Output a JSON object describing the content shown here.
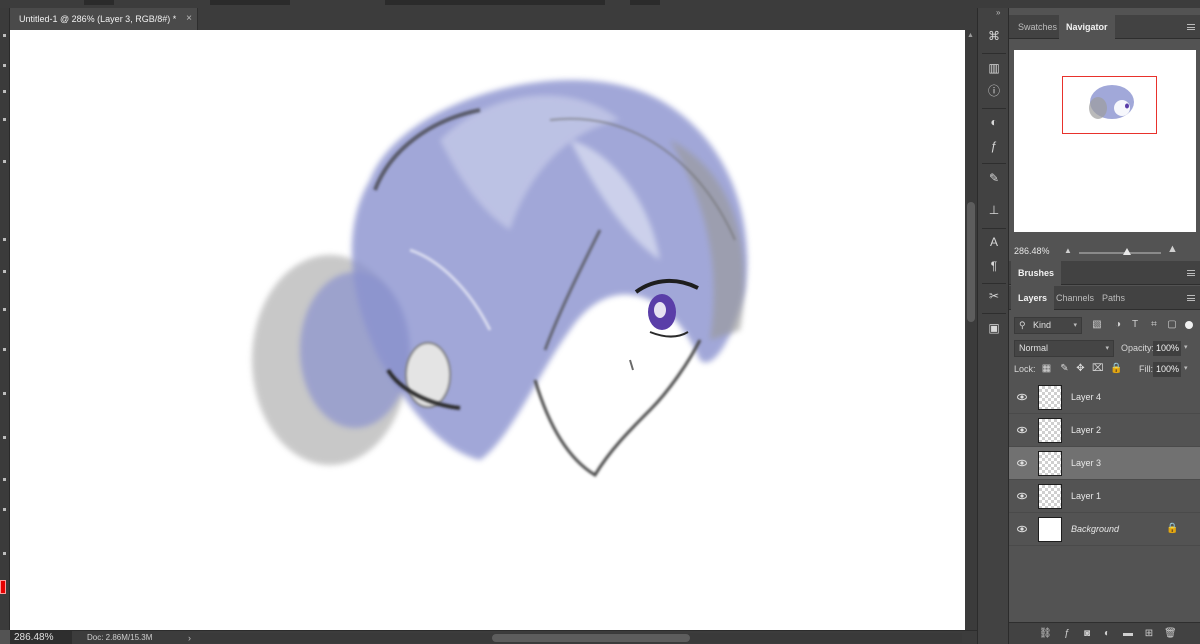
{
  "document": {
    "tab_title": "Untitled-1 @ 286% (Layer 3, RGB/8#) *",
    "close_glyph": "×"
  },
  "statusbar": {
    "zoom": "286.48%",
    "doc_info": "Doc: 2.86M/15.3M",
    "arrow": "›"
  },
  "panels": {
    "top_tabs": [
      "Swatches",
      "Navigator"
    ],
    "navigator": {
      "zoom": "286.48%",
      "zoom_out_glyph": "▲",
      "zoom_in_glyph": "▲"
    },
    "brushes_tab": "Brushes",
    "layer_tabs": [
      "Layers",
      "Channels",
      "Paths"
    ]
  },
  "layers": {
    "filter_kind": "Kind",
    "blend_mode": "Normal",
    "opacity_label": "Opacity:",
    "opacity_value": "100%",
    "lock_label": "Lock:",
    "fill_label": "Fill:",
    "fill_value": "100%",
    "items": [
      {
        "name": "Layer 4",
        "selected": false
      },
      {
        "name": "Layer 2",
        "selected": false
      },
      {
        "name": "Layer 3",
        "selected": true
      },
      {
        "name": "Layer 1",
        "selected": false
      },
      {
        "name": "Background",
        "selected": false,
        "locked": true
      }
    ]
  },
  "icons": {
    "iconcol": [
      "history-brush-icon",
      "histogram-icon",
      "info-icon",
      "adjustments-icon",
      "styles-fx-icon",
      "brush-settings-icon",
      "clone-source-icon",
      "character-icon",
      "paragraph-icon",
      "tool-presets-icon",
      "properties-icon"
    ]
  },
  "colors": {
    "foreground": "#e60000",
    "panel_bg": "#535353",
    "selected_layer": "#717171",
    "navigator_frame": "#e8322c",
    "hair_tint": "#8a92cf"
  }
}
